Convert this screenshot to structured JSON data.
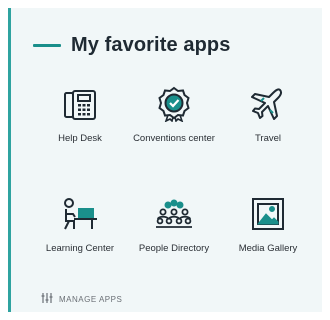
{
  "header": {
    "title": "My favorite apps"
  },
  "apps": [
    {
      "label": "Help Desk",
      "icon": "phone-icon"
    },
    {
      "label": "Conventions center",
      "icon": "badge-icon"
    },
    {
      "label": "Travel",
      "icon": "airplane-icon"
    },
    {
      "label": "Learning Center",
      "icon": "learning-icon"
    },
    {
      "label": "People Directory",
      "icon": "people-icon"
    },
    {
      "label": "Media Gallery",
      "icon": "image-icon"
    }
  ],
  "manage": {
    "label": "MANAGE APPS",
    "icon": "sliders-icon"
  },
  "colors": {
    "accent": "#1a8f8b",
    "background": "#f1f7f8",
    "icon": "#1f2a33"
  }
}
